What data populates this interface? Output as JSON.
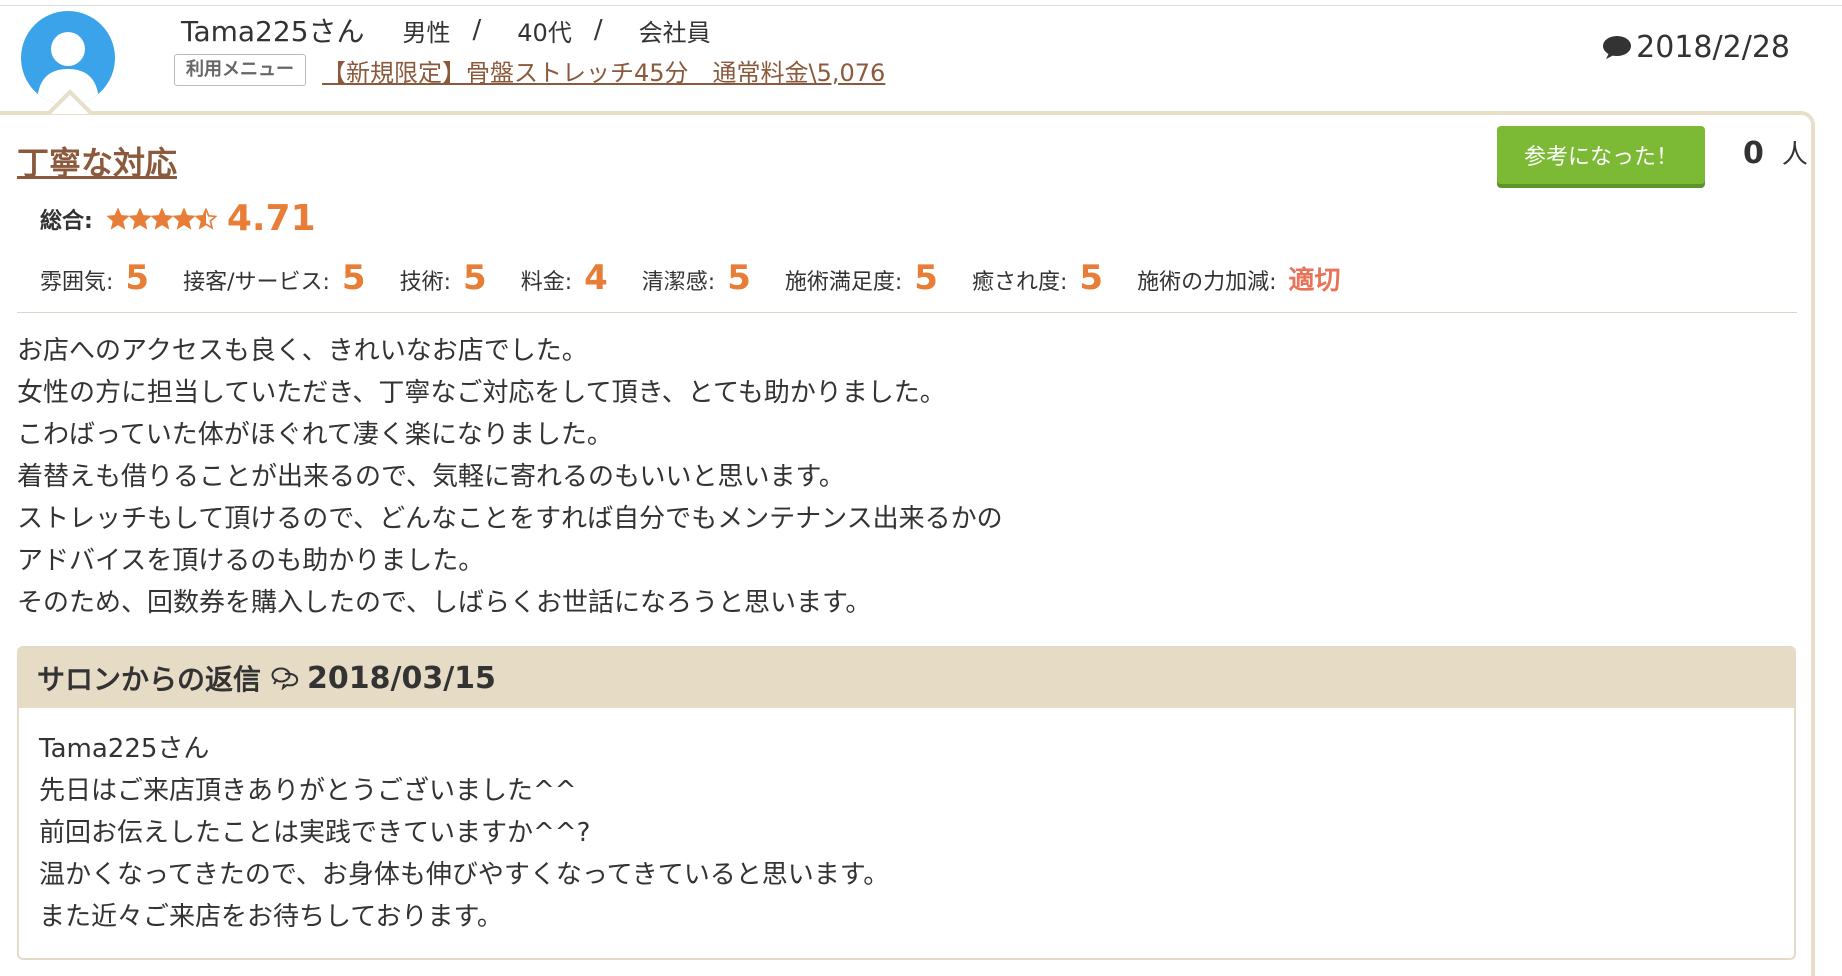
{
  "user": {
    "name": "Tama225さん",
    "gender": "男性",
    "age": "40代",
    "occupation": "会社員",
    "separator": "/"
  },
  "menu": {
    "badge": "利用メニュー",
    "link": "【新規限定】骨盤ストレッチ45分　通常料金\\5,076"
  },
  "post_date": "2018/2/28",
  "review": {
    "title": "丁寧な対応",
    "helpful_button": "参考になった！",
    "helpful_count": "0",
    "helpful_unit": "人",
    "overall_label": "総合:",
    "overall_score": "4.71",
    "overall_stars": 4.71,
    "sub_ratings": [
      {
        "label": "雰囲気:",
        "value": "5"
      },
      {
        "label": "接客/サービス:",
        "value": "5"
      },
      {
        "label": "技術:",
        "value": "5"
      },
      {
        "label": "料金:",
        "value": "4"
      },
      {
        "label": "清潔感:",
        "value": "5"
      },
      {
        "label": "施術満足度:",
        "value": "5"
      },
      {
        "label": "癒され度:",
        "value": "5"
      },
      {
        "label": "施術の力加減:",
        "value": "適切"
      }
    ],
    "body_lines": [
      "お店へのアクセスも良く、きれいなお店でした。",
      "女性の方に担当していただき、丁寧なご対応をして頂き、とても助かりました。",
      "こわばっていた体がほぐれて凄く楽になりました。",
      "着替えも借りることが出来るので、気軽に寄れるのもいいと思います。",
      "ストレッチもして頂けるので、どんなことをすれば自分でもメンテナンス出来るかの",
      "アドバイスを頂けるのも助かりました。",
      "そのため、回数券を購入したので、しばらくお世話になろうと思います。"
    ]
  },
  "reply": {
    "title": "サロンからの返信",
    "date": "2018/03/15",
    "body_lines": [
      "Tama225さん",
      "先日はご来店頂きありがとうございました^^",
      "前回お伝えしたことは実践できていますか^^?",
      "温かくなってきたので、お身体も伸びやすくなってきていると思います。",
      "また近々ご来店をお待ちしております。"
    ]
  },
  "colors": {
    "accent_orange": "#e87d38",
    "link_brown": "#8b5a3c",
    "button_green": "#7cba36",
    "reply_header": "#e6dcc6",
    "avatar_blue": "#3aa3ea"
  },
  "icons": {
    "avatar": "user-silhouette-icon",
    "date": "speech-bubble-icon",
    "reply": "chat-bubbles-icon",
    "stars": "star-icon"
  }
}
